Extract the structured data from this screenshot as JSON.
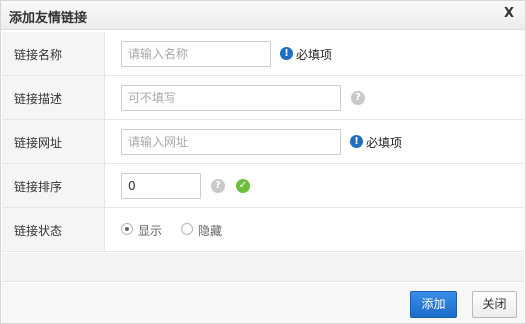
{
  "dialog": {
    "title": "添加友情链接",
    "close_label": "X"
  },
  "form": {
    "name": {
      "label": "链接名称",
      "placeholder": "请输入名称",
      "value": "",
      "required_text": "必填项"
    },
    "desc": {
      "label": "链接描述",
      "placeholder": "可不填写",
      "value": ""
    },
    "url": {
      "label": "链接网址",
      "placeholder": "请输入网址",
      "value": "",
      "required_text": "必填项"
    },
    "order": {
      "label": "链接排序",
      "value": "0"
    },
    "status": {
      "label": "链接状态",
      "options": [
        {
          "label": "显示",
          "checked": true
        },
        {
          "label": "隐藏",
          "checked": false
        }
      ]
    }
  },
  "icons": {
    "required": "info-circle-icon",
    "help": "question-circle-icon",
    "valid": "check-circle-icon"
  },
  "footer": {
    "add_label": "添加",
    "close_label": "关闭"
  },
  "colors": {
    "primary": "#1c6cc9",
    "required_icon": "#1f6fbf",
    "valid_icon": "#6cbf3a",
    "help_icon": "#c9c9c9"
  }
}
